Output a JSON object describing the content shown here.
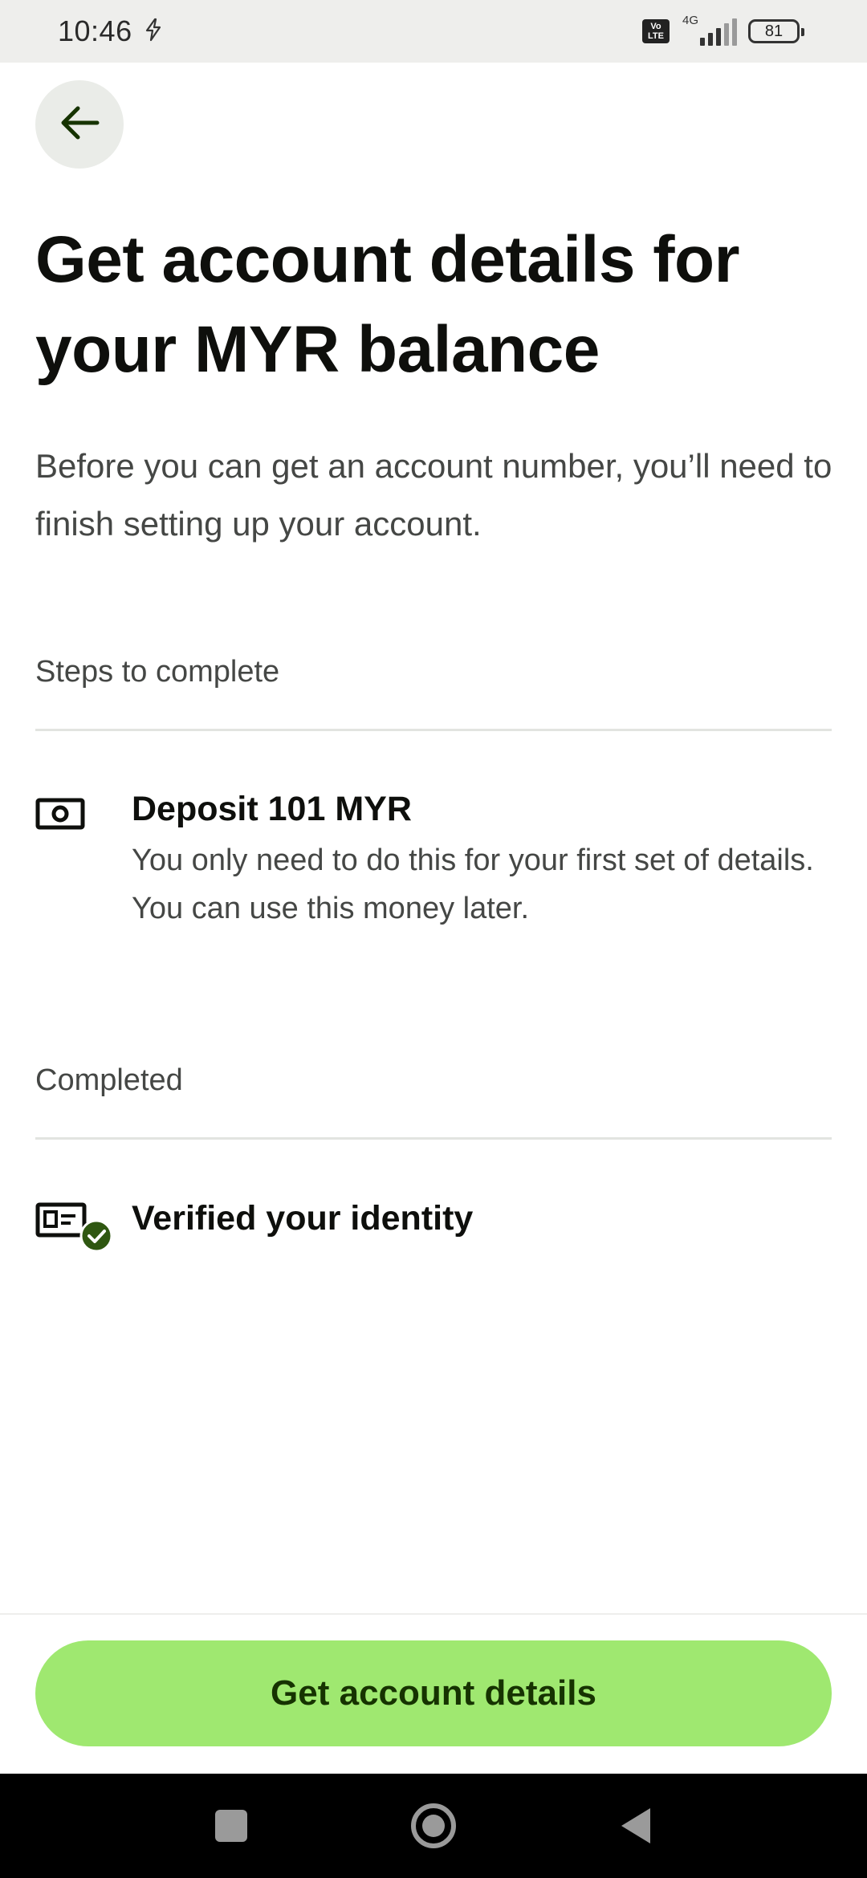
{
  "status_bar": {
    "time": "10:46",
    "volte_top": "Vo",
    "volte_bottom": "LTE",
    "network": "4G",
    "battery": "81"
  },
  "header": {
    "back_icon": "arrow-left-icon",
    "title": "Get account details for your MYR balance",
    "description": "Before you can get an account number, you’ll need to finish setting up your account."
  },
  "steps_section": {
    "label": "Steps to complete",
    "items": [
      {
        "icon": "cash-icon",
        "title": "Deposit 101 MYR",
        "description": "You only need to do this for your first set of details. You can use this money later."
      }
    ]
  },
  "completed_section": {
    "label": "Completed",
    "items": [
      {
        "icon": "id-card-verified-icon",
        "title": "Verified your identity"
      }
    ]
  },
  "footer": {
    "button_label": "Get account details"
  },
  "colors": {
    "accent": "#9fe870",
    "accent_text": "#163300",
    "check": "#2f5711"
  }
}
